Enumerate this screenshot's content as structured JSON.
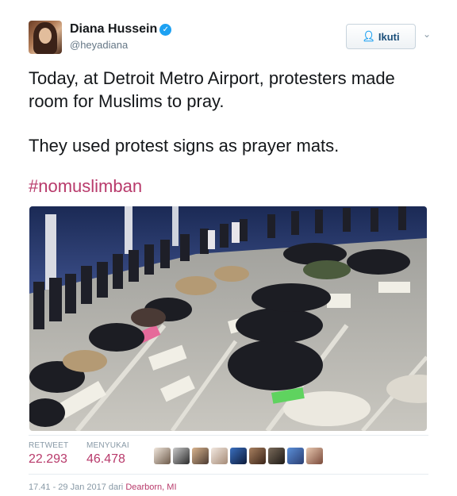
{
  "user": {
    "name": "Diana Hussein",
    "handle": "@heyadiana",
    "verified": true
  },
  "actions": {
    "follow_label": "Ikuti"
  },
  "tweet": {
    "line1": "Today, at Detroit Metro Airport, protesters made room for Muslims to pray.",
    "line2": "They used protest signs as prayer mats.",
    "hashtag": "#nomuslimban"
  },
  "stats": {
    "retweet_label": "RETWEET",
    "retweet_count": "22.293",
    "likes_label": "MENYUKAI",
    "likes_count": "46.478"
  },
  "meta": {
    "time": "17.41 - 29 Jan 2017 dari ",
    "location": "Dearborn, MI"
  },
  "colors": {
    "accent": "#b83a6b",
    "verified": "#1da1f2",
    "muted": "#8899a6"
  },
  "icons": {
    "verified": "verified-badge-icon",
    "follow": "add-user-icon",
    "menu": "chevron-down-icon"
  }
}
